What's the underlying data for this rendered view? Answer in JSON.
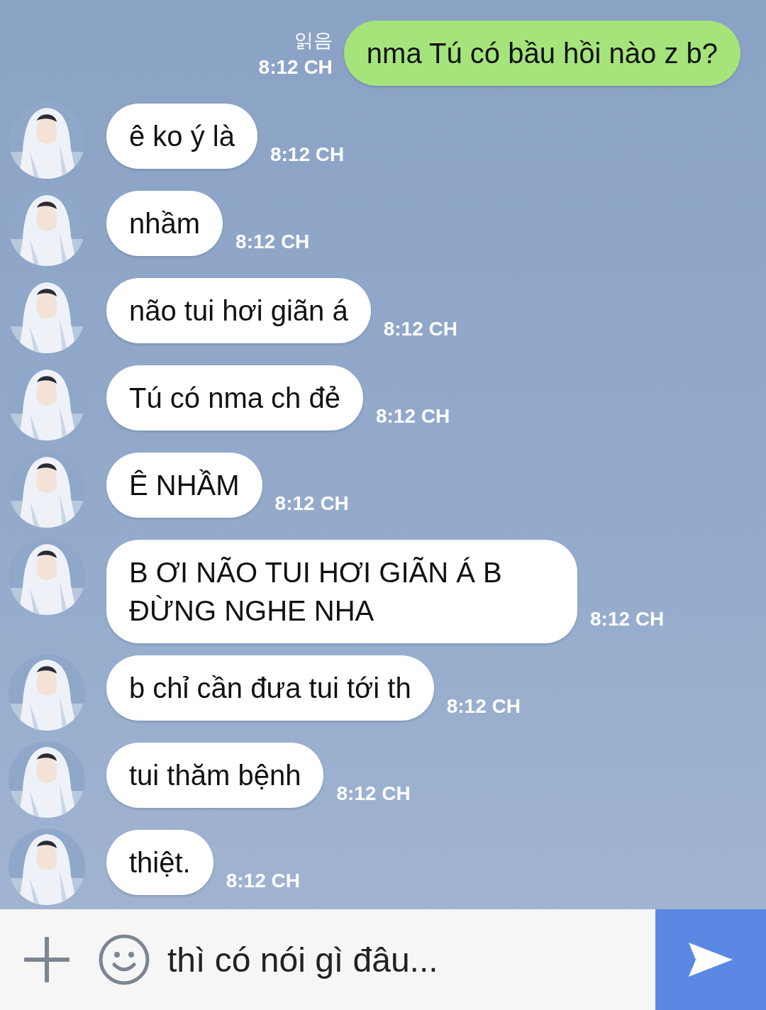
{
  "messages": [
    {
      "kind": "sent",
      "text": "nma Tú có bầu hồi nào z b?",
      "time": "8:12 CH",
      "read_label": "읽음"
    },
    {
      "kind": "received",
      "text": "ê ko ý là",
      "time": "8:12 CH"
    },
    {
      "kind": "received",
      "text": "nhầm",
      "time": "8:12 CH"
    },
    {
      "kind": "received",
      "text": "não tui hơi giãn á",
      "time": "8:12 CH"
    },
    {
      "kind": "received",
      "text": "Tú có nma ch đẻ",
      "time": "8:12 CH"
    },
    {
      "kind": "received",
      "text": "Ê NHẦM",
      "time": "8:12 CH"
    },
    {
      "kind": "received",
      "text": "B ƠI NÃO TUI HƠI GIÃN Á B ĐỪNG NGHE NHA",
      "time": "8:12 CH"
    },
    {
      "kind": "received",
      "text": "b chỉ cần đưa tui tới th",
      "time": "8:12 CH"
    },
    {
      "kind": "received",
      "text": "tui thăm bệnh",
      "time": "8:12 CH"
    },
    {
      "kind": "received",
      "text": "thiệt.",
      "time": "8:12 CH"
    }
  ],
  "composer": {
    "value": "thì có nói gì đâu..."
  }
}
